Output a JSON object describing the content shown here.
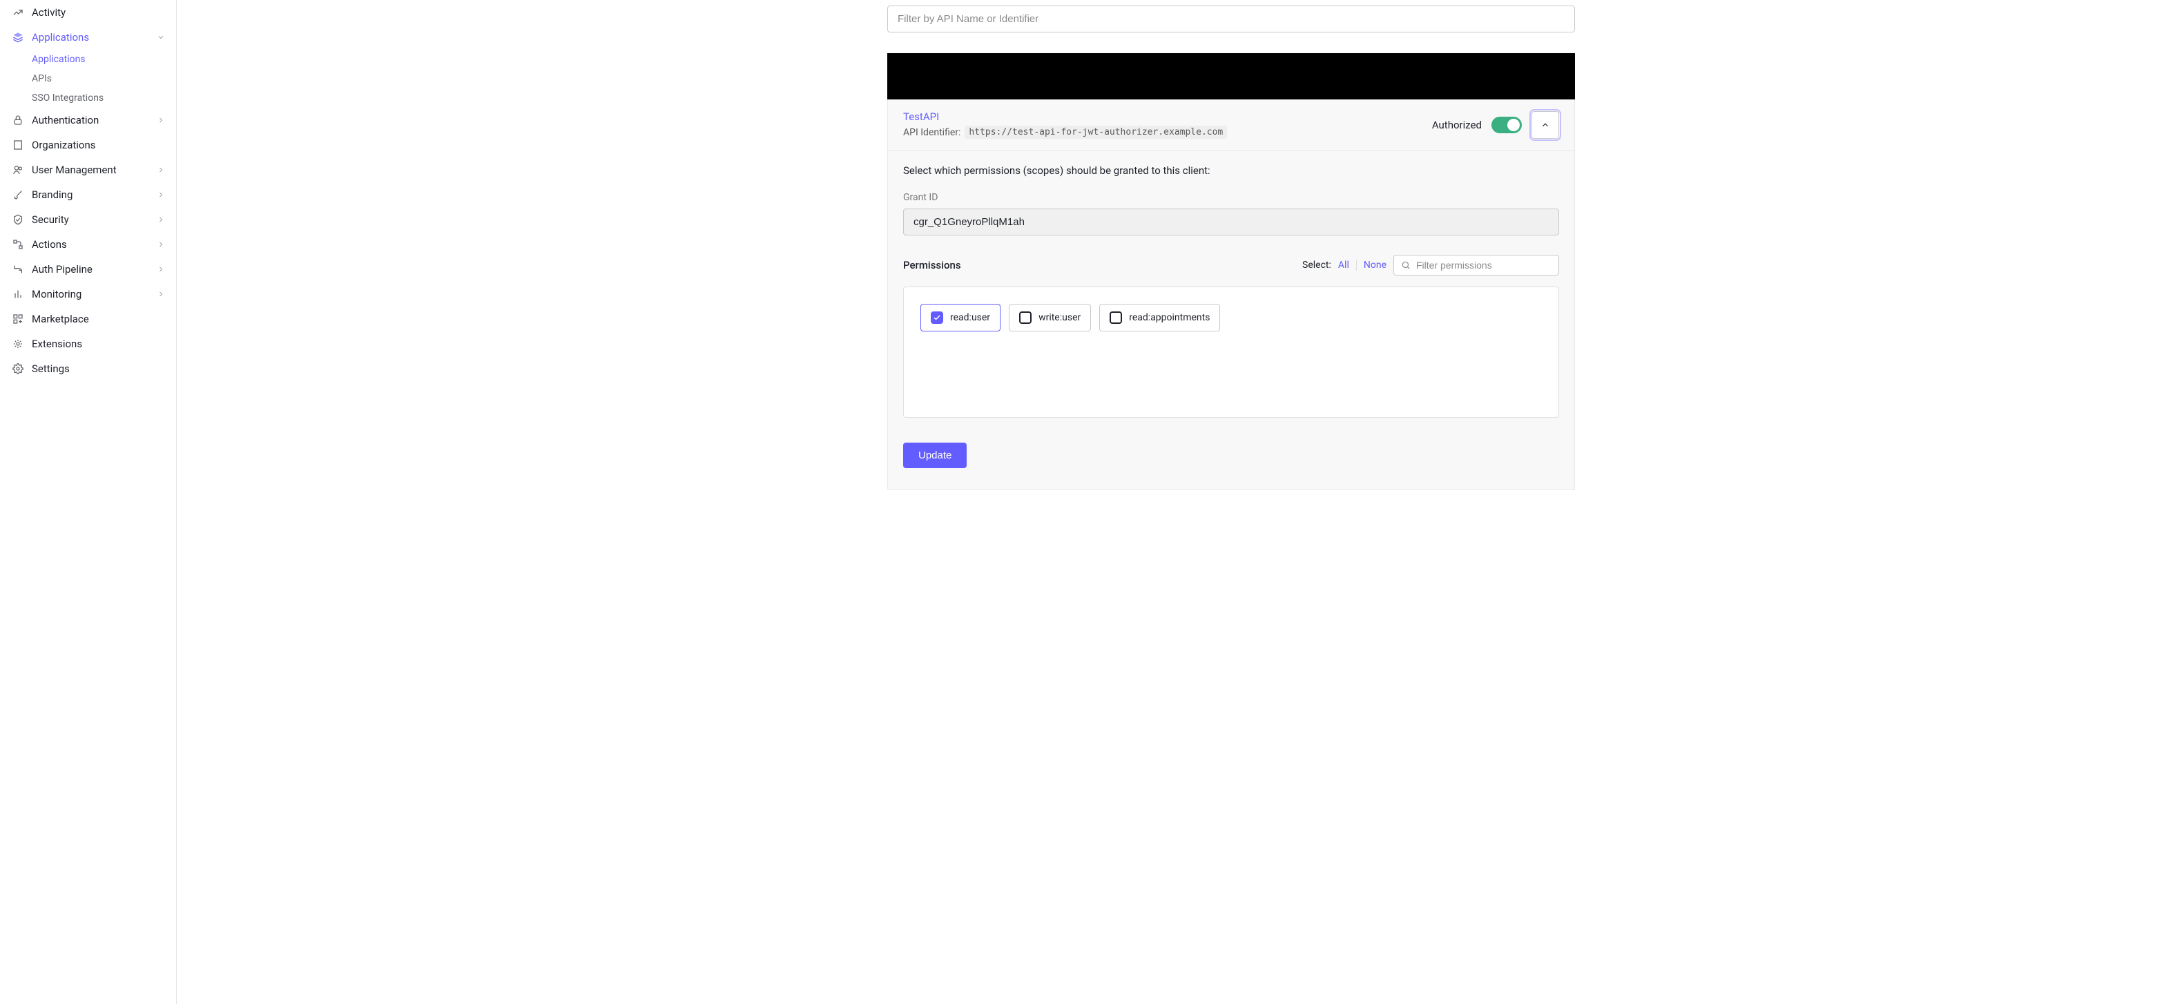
{
  "sidebar": {
    "items": [
      {
        "label": "Activity",
        "icon": "activity"
      },
      {
        "label": "Applications",
        "icon": "applications",
        "active": true,
        "expanded": true,
        "children": [
          {
            "label": "Applications",
            "active": true
          },
          {
            "label": "APIs"
          },
          {
            "label": "SSO Integrations"
          }
        ]
      },
      {
        "label": "Authentication",
        "icon": "authentication",
        "chevron": true
      },
      {
        "label": "Organizations",
        "icon": "organizations"
      },
      {
        "label": "User Management",
        "icon": "user-management",
        "chevron": true
      },
      {
        "label": "Branding",
        "icon": "branding",
        "chevron": true
      },
      {
        "label": "Security",
        "icon": "security",
        "chevron": true
      },
      {
        "label": "Actions",
        "icon": "actions",
        "chevron": true
      },
      {
        "label": "Auth Pipeline",
        "icon": "pipeline",
        "chevron": true
      },
      {
        "label": "Monitoring",
        "icon": "monitoring",
        "chevron": true
      },
      {
        "label": "Marketplace",
        "icon": "marketplace"
      },
      {
        "label": "Extensions",
        "icon": "extensions"
      },
      {
        "label": "Settings",
        "icon": "settings"
      }
    ]
  },
  "main": {
    "filter_placeholder": "Filter by API Name or Identifier",
    "api": {
      "name": "TestAPI",
      "identifier_label": "API Identifier:",
      "identifier_value": "https://test-api-for-jwt-authorizer.example.com",
      "authorized_label": "Authorized",
      "scopes_description": "Select which permissions (scopes) should be granted to this client:",
      "grant_id_label": "Grant ID",
      "grant_id_value": "cgr_Q1GneyroPllqM1ah",
      "permissions_title": "Permissions",
      "select_label": "Select:",
      "select_all": "All",
      "select_none": "None",
      "perm_filter_placeholder": "Filter permissions",
      "permissions": [
        {
          "label": "read:user",
          "checked": true
        },
        {
          "label": "write:user",
          "checked": false
        },
        {
          "label": "read:appointments",
          "checked": false
        }
      ],
      "update_label": "Update"
    }
  }
}
